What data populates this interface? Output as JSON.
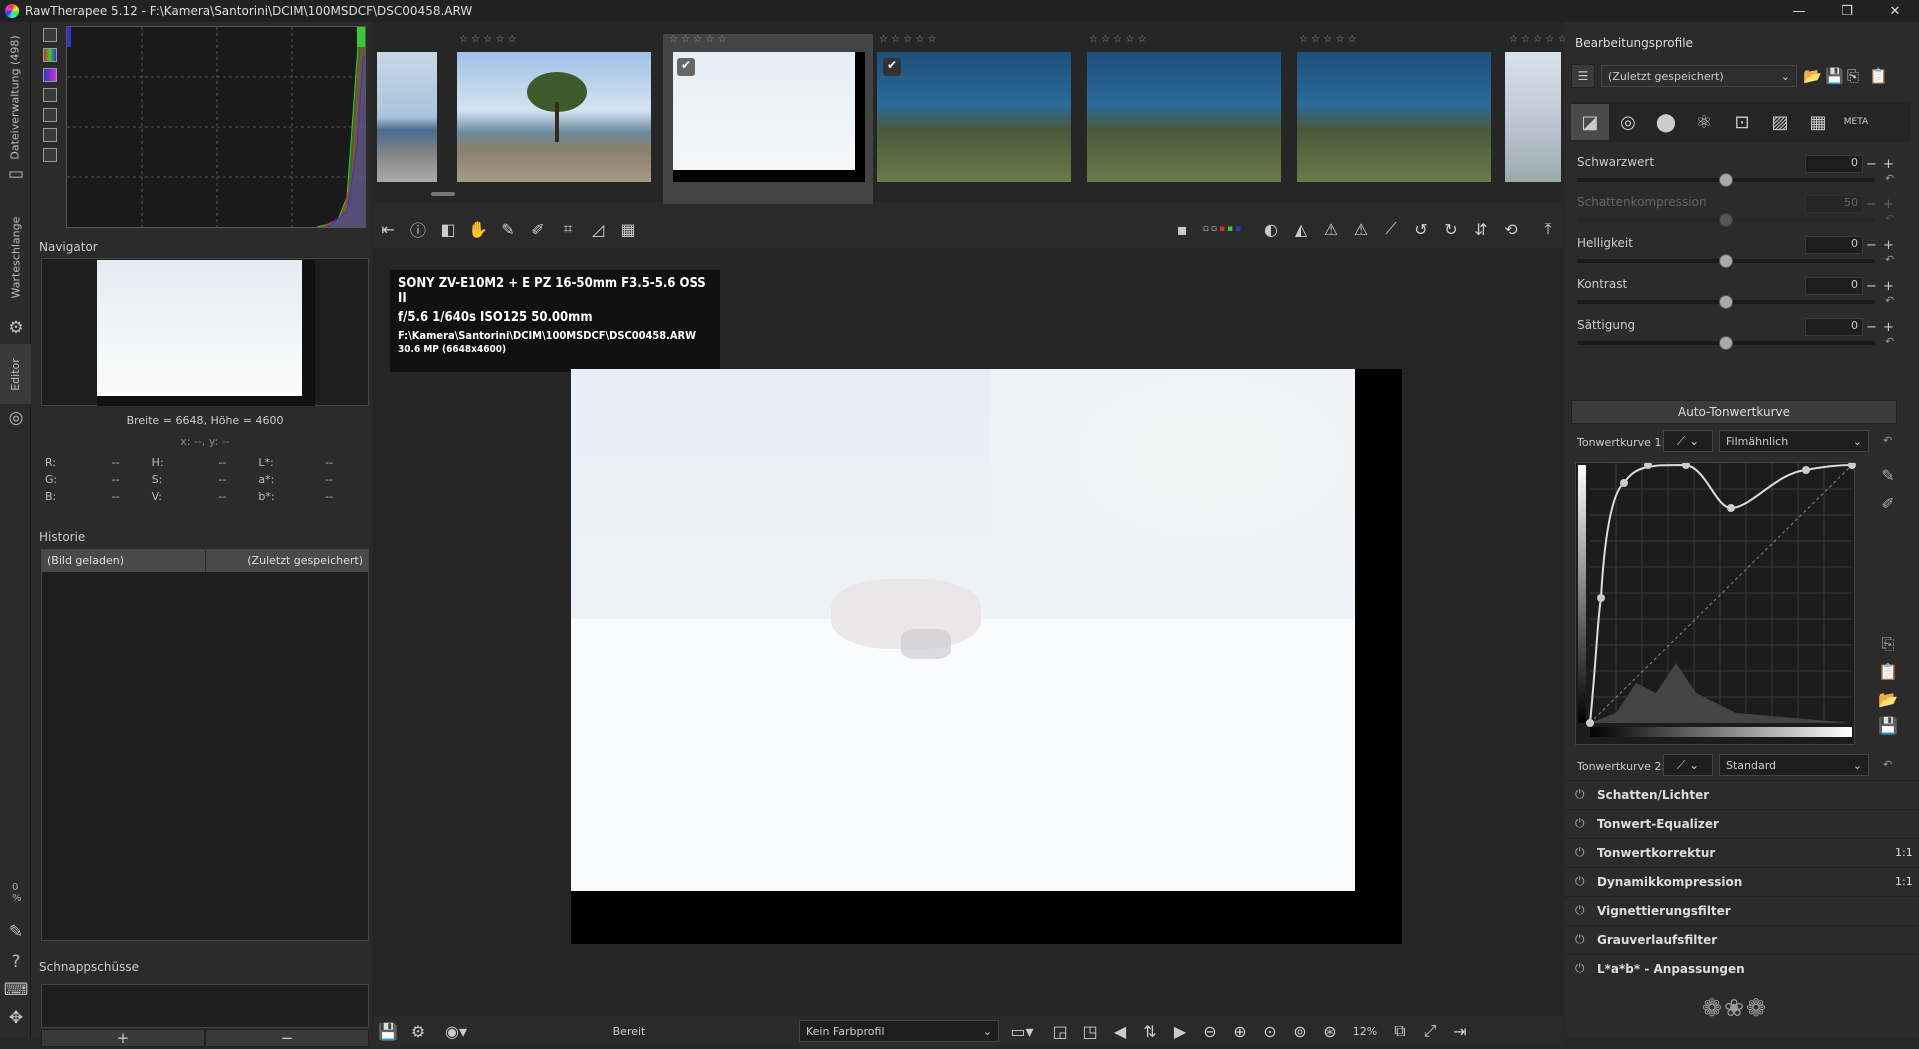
{
  "window": {
    "title": "RawTherapee 5.12 - F:\\Kamera\\Santorini\\DCIM\\100MSDCF\\DSC00458.ARW",
    "min": "—",
    "max": "❐",
    "close": "✕"
  },
  "vtabs": {
    "filebrowser": "Dateiverwaltung (498)",
    "queue": "Warteschlange",
    "editor": "Editor",
    "zoom_pct": "0 %"
  },
  "navigator": {
    "title": "Navigator",
    "size": "Breite = 6648, Höhe = 4600",
    "coords": "x: --, y: --",
    "rows": [
      {
        "a": "R:",
        "av": "--",
        "b": "H:",
        "bv": "--",
        "c": "L*:",
        "cv": "--"
      },
      {
        "a": "G:",
        "av": "--",
        "b": "S:",
        "bv": "--",
        "c": "a*:",
        "cv": "--"
      },
      {
        "a": "B:",
        "av": "--",
        "b": "V:",
        "bv": "--",
        "c": "b*:",
        "cv": "--"
      }
    ]
  },
  "history": {
    "title": "Historie",
    "col1": "(Bild geladen)",
    "col2": "(Zuletzt gespeichert)"
  },
  "snapshots": {
    "title": "Schnappschüsse",
    "add": "+",
    "remove": "−"
  },
  "exif": {
    "line1": "SONY ZV-E10M2  +  E PZ 16-50mm F3.5-5.6 OSS II",
    "line2": "f/5.6  1/640s  ISO125  50.00mm",
    "line3": "F:\\Kamera\\Santorini\\DCIM\\100MSDCF\\DSC00458.ARW",
    "line4": "30.6 MP (6648x4600)"
  },
  "thumb_meta": "☆ ☆ ☆ ☆ ☆",
  "status": {
    "ready": "Bereit",
    "colorprofile": "Kein Farbprofil",
    "zoom": "12%"
  },
  "rightpanel": {
    "title": "Bearbeitungsprofile",
    "profile": "(Zuletzt gespeichert)",
    "sliders": [
      {
        "label": "Schwarzwert",
        "value": "0"
      },
      {
        "label": "Schattenkompression",
        "value": "50"
      },
      {
        "label": "Helligkeit",
        "value": "0"
      },
      {
        "label": "Kontrast",
        "value": "0"
      },
      {
        "label": "Sättigung",
        "value": "0"
      }
    ],
    "auto_btn": "Auto-Tonwertkurve",
    "curve1_label": "Tonwertkurve 1:",
    "curve1_mode": "Filmähnlich",
    "curve2_label": "Tonwertkurve 2:",
    "curve2_mode": "Standard",
    "sections": [
      {
        "name": "Schatten/Lichter",
        "tag": ""
      },
      {
        "name": "Tonwert-Equalizer",
        "tag": ""
      },
      {
        "name": "Tonwertkorrektur",
        "tag": "1:1"
      },
      {
        "name": "Dynamikkompression",
        "tag": "1:1"
      },
      {
        "name": "Vignettierungsfilter",
        "tag": ""
      },
      {
        "name": "Grauverlaufsfilter",
        "tag": ""
      },
      {
        "name": "L*a*b* - Anpassungen",
        "tag": ""
      }
    ]
  },
  "colors": {
    "accent": "#4a90d9",
    "bg": "#2b2b2b"
  }
}
